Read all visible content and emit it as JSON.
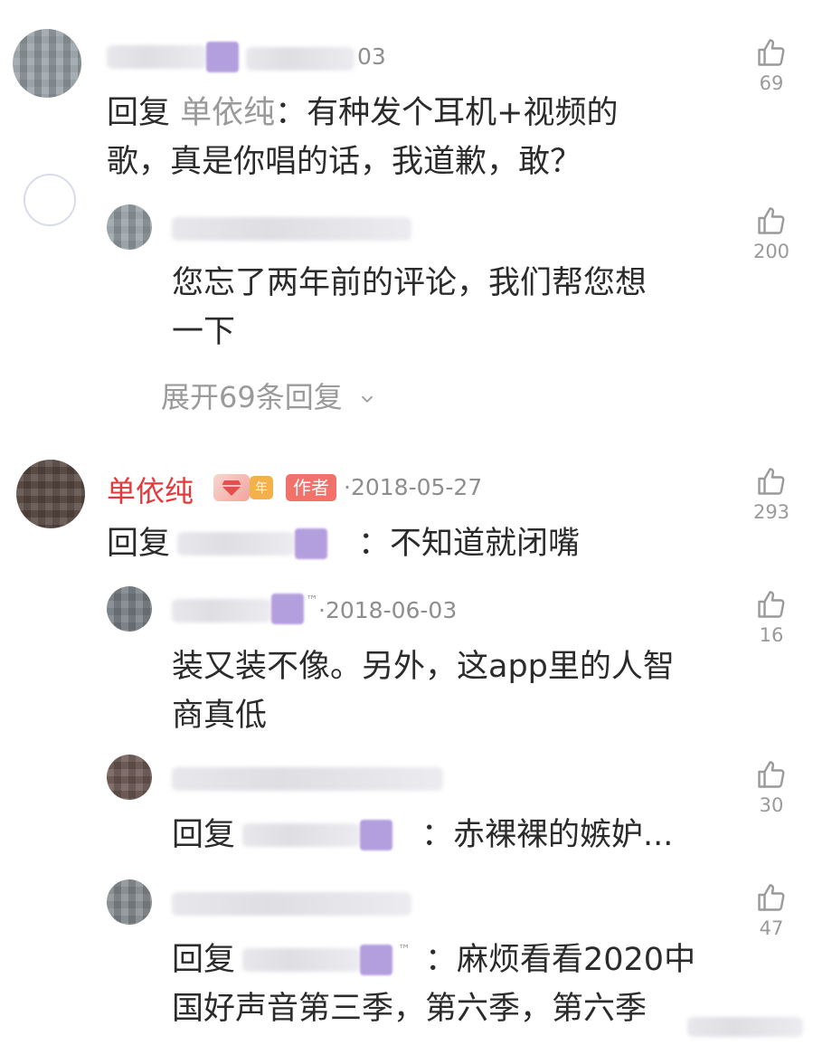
{
  "comments": [
    {
      "date": "03",
      "reply_prefix": "回复",
      "reply_target": "单依纯",
      "body_line1_rest": "：有种发个耳机+视频的",
      "body_line2": "歌，真是你唱的话，我道歉，敢？",
      "likes": "69"
    },
    {
      "body_line1": "您忘了两年前的评论，我们帮您想",
      "body_line2": "一下",
      "likes": "200",
      "expand_label": "展开69条回复"
    },
    {
      "name": "单依纯",
      "badge_year": "年",
      "badge_author": "作者",
      "date": "·2018-05-27",
      "reply_prefix": "回复",
      "body_rest": "：不知道就闭嘴",
      "likes": "293"
    },
    {
      "date": "·2018-06-03",
      "body_line1": "装又装不像。另外，这app里的人智",
      "body_line2": "商真低",
      "likes": "16"
    },
    {
      "reply_prefix": "回复",
      "body_rest": "：赤裸裸的嫉妒...",
      "likes": "30"
    },
    {
      "reply_prefix": "回复",
      "body_line1_rest": "：麻烦看看2020中",
      "body_line2": "国好声音第三季，第六季，第六季",
      "likes": "47"
    }
  ],
  "icons": {
    "like": "thumbs-up-outline-icon",
    "expand": "chevron-down-icon"
  },
  "colors": {
    "author_name": "#e4393c",
    "meta_gray": "#8e8e8e",
    "text": "#2b2b2b",
    "author_badge": "#f1716b",
    "mask_purple": "#9b7fd4"
  }
}
